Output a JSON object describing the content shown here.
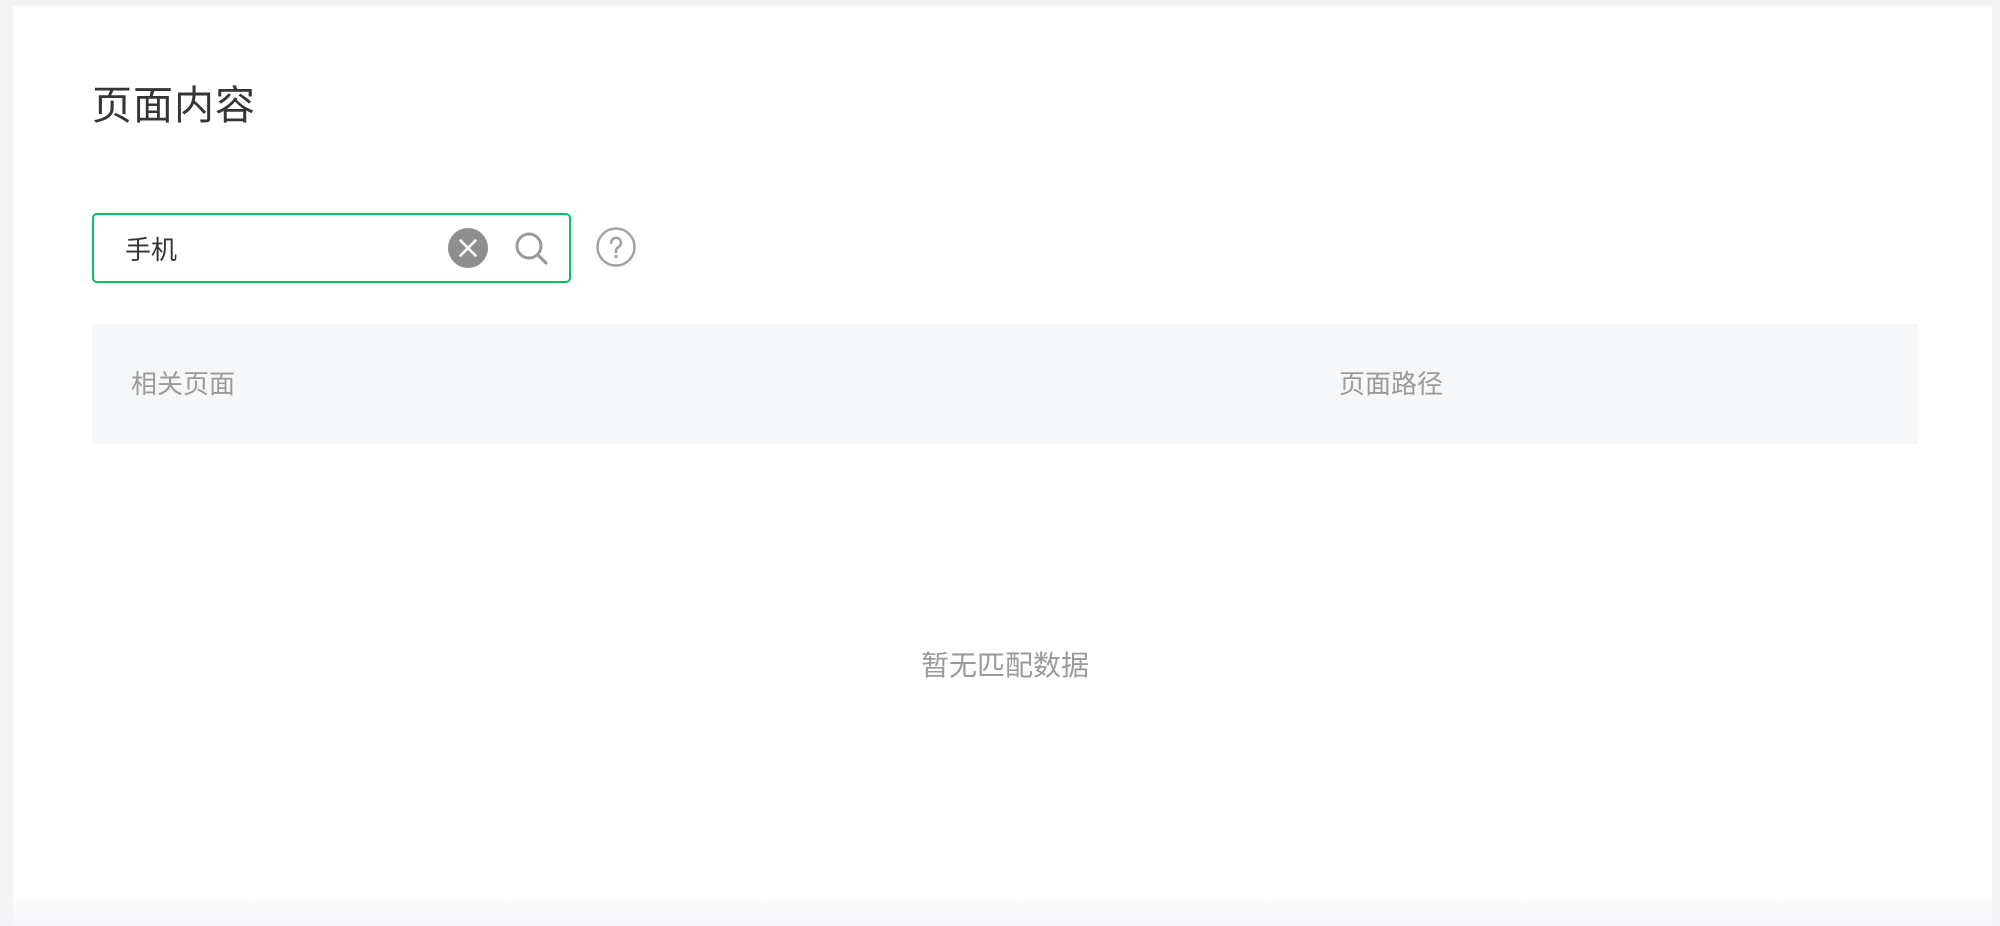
{
  "page": {
    "title": "页面内容"
  },
  "search": {
    "value": "手机",
    "clear_icon": "clear-icon",
    "search_icon": "search-icon"
  },
  "help": {
    "icon": "help-icon"
  },
  "table": {
    "columns": [
      "相关页面",
      "页面路径"
    ],
    "empty_text": "暂无匹配数据"
  },
  "colors": {
    "accent": "#07c160",
    "background": "#f3f4f6",
    "panel": "#ffffff",
    "header_bg": "#f6f7f9",
    "muted_text": "#9a9a9a",
    "text": "#353535",
    "icon_gray": "#999999"
  }
}
